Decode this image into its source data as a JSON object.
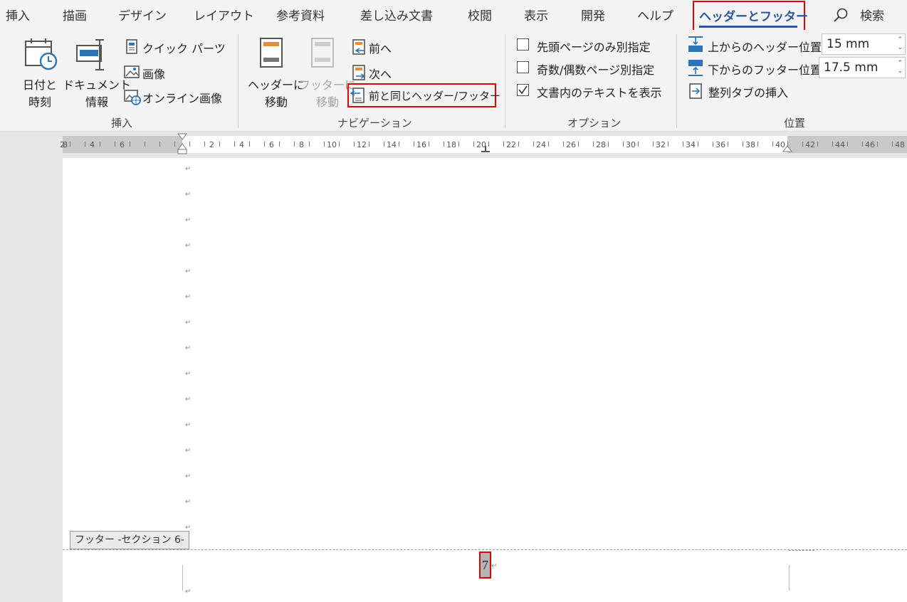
{
  "menu": {
    "tabs": [
      "挿入",
      "描画",
      "デザイン",
      "レイアウト",
      "参考資料",
      "差し込み文書",
      "校閲",
      "表示",
      "開発",
      "ヘルプ",
      "ヘッダーとフッター"
    ],
    "search_label": "検索"
  },
  "ribbon": {
    "insert": {
      "date_time": "日付と\n時刻",
      "document_info": "ドキュメント\n情報",
      "quick_parts": "クイック パーツ",
      "pictures": "画像",
      "online_pictures": "オンライン画像",
      "group_label": "挿入"
    },
    "navigation": {
      "go_to_header": "ヘッダーに\n移動",
      "go_to_footer": "フッターに\n移動",
      "previous": "前へ",
      "next": "次へ",
      "link_to_previous": "前と同じヘッダー/フッター",
      "group_label": "ナビゲーション"
    },
    "options": {
      "different_first_page": "先頭ページのみ別指定",
      "different_odd_even": "奇数/偶数ページ別指定",
      "show_document_text": "文書内のテキストを表示",
      "show_document_text_checked": true,
      "group_label": "オプション"
    },
    "position": {
      "header_from_top_label": "上からのヘッダー位置:",
      "header_from_top_value": "15 mm",
      "footer_from_bottom_label": "下からのフッター位置:",
      "footer_from_bottom_value": "17.5 mm",
      "insert_alignment_tab": "整列タブの挿入",
      "group_label": "位置"
    }
  },
  "ruler": {
    "left_ticks": [
      "8",
      "6",
      "4",
      "2"
    ],
    "ticks": [
      "2",
      "4",
      "6",
      "8",
      "10",
      "12",
      "14",
      "16",
      "18",
      "20",
      "22",
      "24",
      "26",
      "28",
      "30",
      "32",
      "34",
      "36",
      "38",
      "40",
      "42",
      "44",
      "46",
      "48"
    ]
  },
  "document": {
    "paragraph_mark": "↵",
    "footer_label": "フッター -セクション 6-",
    "page_number": "7"
  },
  "colors": {
    "accent": "#2b579a",
    "highlight": "#e00000"
  }
}
